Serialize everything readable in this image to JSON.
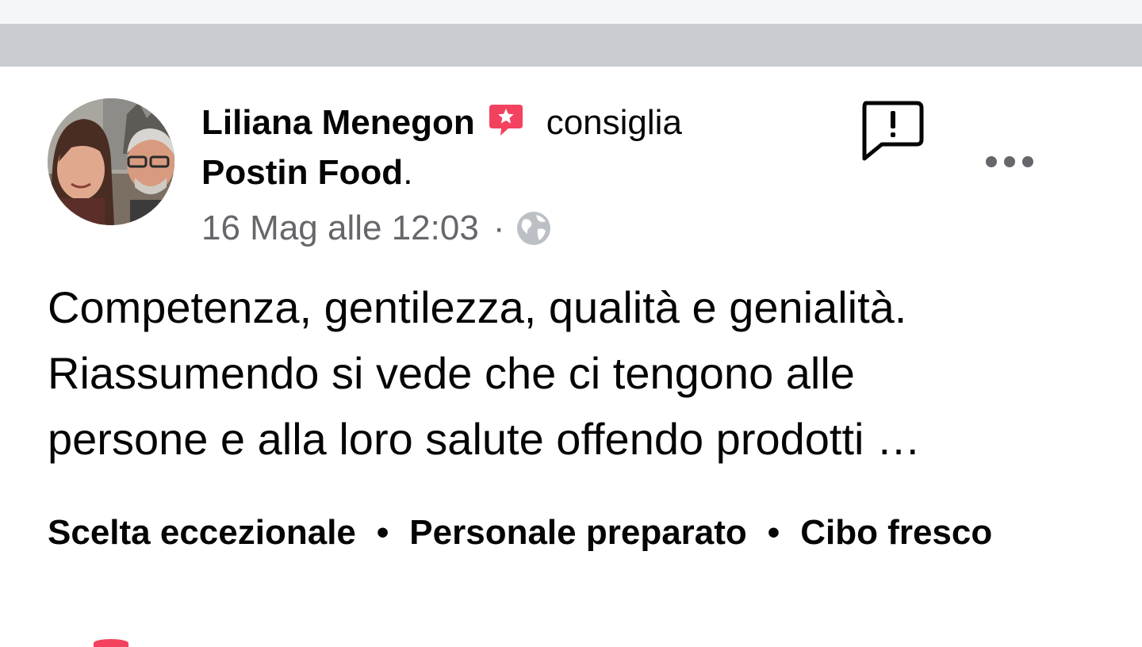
{
  "post": {
    "author_name": "Liliana Menegon",
    "action": "consiglia",
    "page_name": "Postin Food",
    "page_suffix": ".",
    "timestamp": "16 Mag alle 12:03",
    "meta_separator": "·",
    "privacy_icon": "globe-icon",
    "recommend_icon": "recommend-star-bubble-icon",
    "report_icon": "report-exclamation-icon",
    "more_icon": "more-options-icon"
  },
  "review": {
    "lines": [
      "Competenza, gentilezza, qualità e genialità.",
      "Riassumendo si vede che ci tengono alle",
      "persone e alla loro salute offendo prodotti …"
    ]
  },
  "tags": {
    "items": [
      "Scelta eccezionale",
      "Personale preparato",
      "Cibo fresco"
    ],
    "separator": "•"
  },
  "colors": {
    "recommend_accent": "#f3425f",
    "secondary_text": "#65676b",
    "separator_bar": "#c9ccd1"
  }
}
